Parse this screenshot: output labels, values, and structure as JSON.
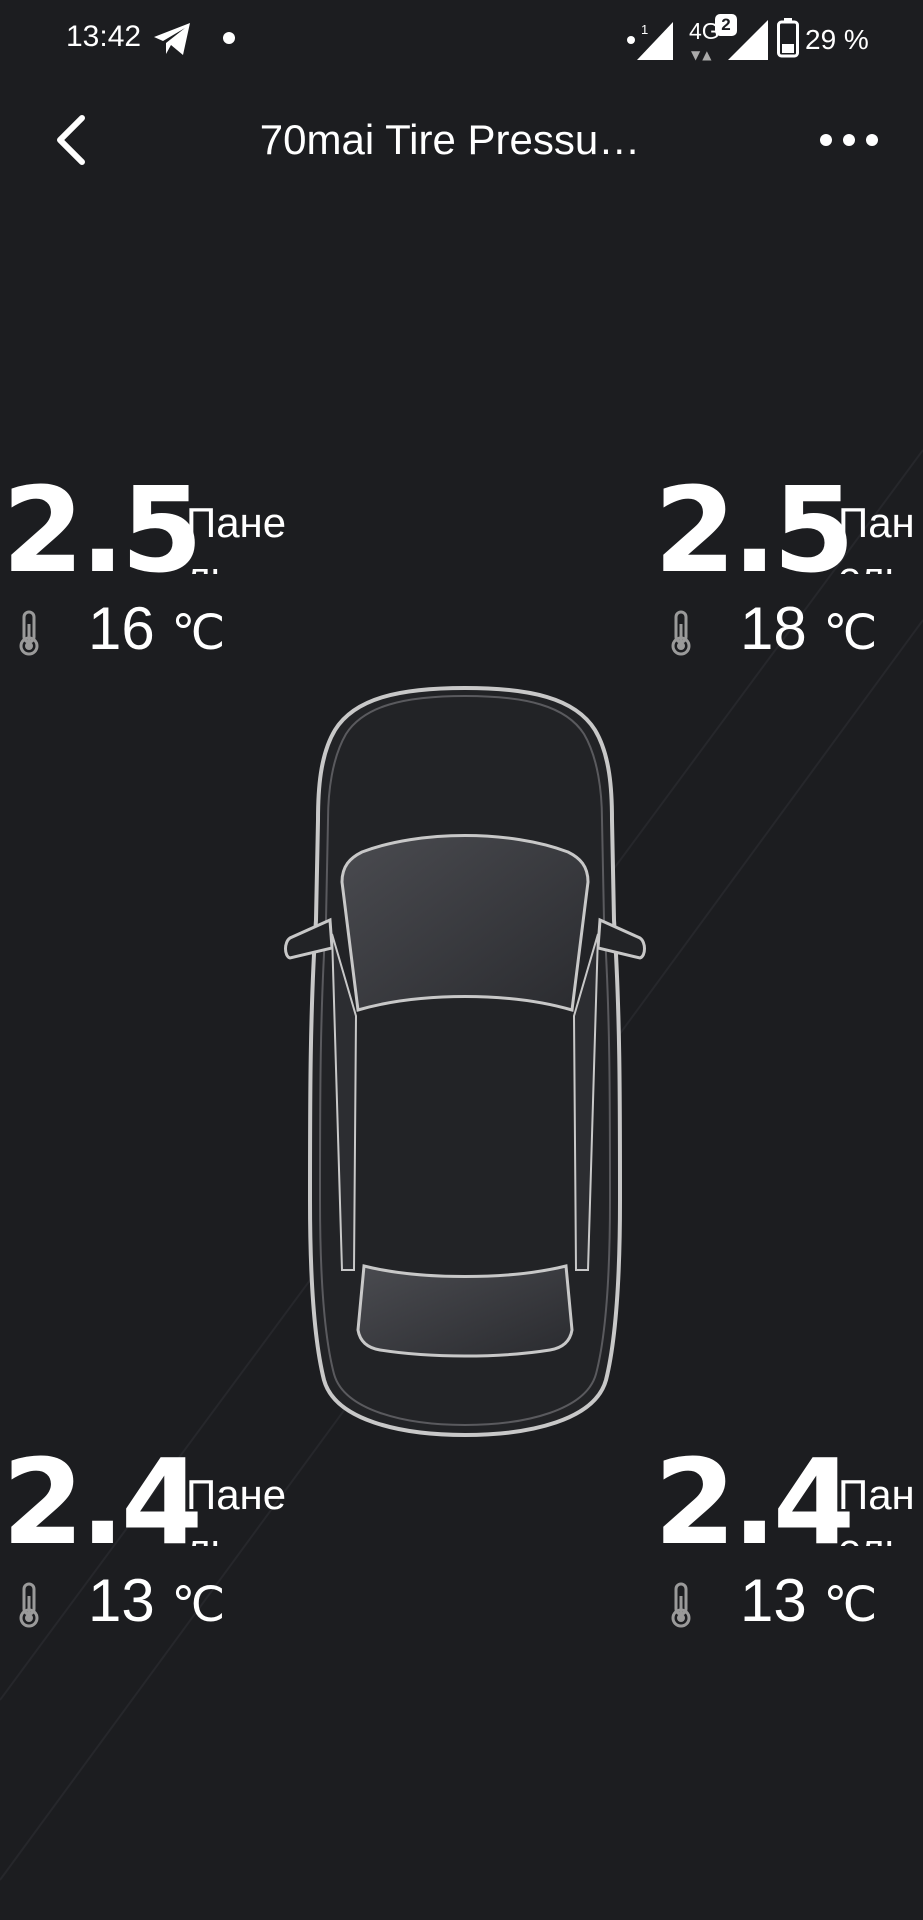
{
  "status_bar": {
    "time": "13:42",
    "network": "4G",
    "sim_slot_1": "1",
    "sim_slot_2": "2",
    "battery": "29 %"
  },
  "header": {
    "title": "70mai Tire Pressu…"
  },
  "tires": {
    "front_left": {
      "pressure": "2.5",
      "unit": "Панель",
      "temp": "16",
      "temp_unit": "℃"
    },
    "front_right": {
      "pressure": "2.5",
      "unit": "Панель",
      "temp": "18",
      "temp_unit": "℃"
    },
    "rear_left": {
      "pressure": "2.4",
      "unit": "Панель",
      "temp": "13",
      "temp_unit": "℃"
    },
    "rear_right": {
      "pressure": "2.4",
      "unit": "Панель",
      "temp": "13",
      "temp_unit": "℃"
    }
  },
  "icons": [
    "back-arrow-icon",
    "more-dots-icon",
    "thermometer-icon",
    "telegram-icon",
    "signal-icon",
    "battery-icon",
    "car-icon"
  ],
  "colors": {
    "background": "#1c1d20",
    "text": "#ffffff",
    "car_outline": "#c8c8c8"
  }
}
